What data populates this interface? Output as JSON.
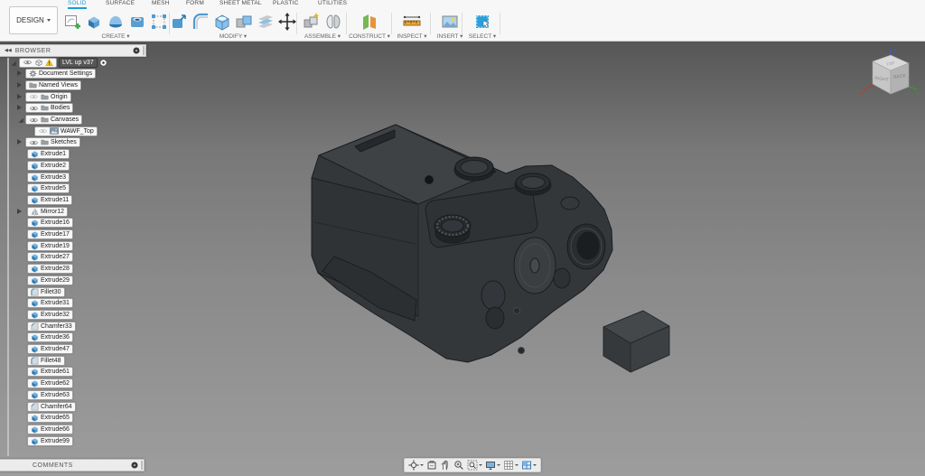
{
  "toolbar": {
    "design_label": "DESIGN",
    "tabs": [
      "SOLID",
      "SURFACE",
      "MESH",
      "FORM",
      "SHEET METAL",
      "PLASTIC",
      "UTILITIES"
    ],
    "active_tab": "SOLID",
    "accent_color": "#1e9bd7",
    "groups": [
      {
        "label": "CREATE",
        "icons": [
          "create-sketch-icon",
          "extrude-icon",
          "revolve-icon",
          "hole-icon",
          "pattern-icon"
        ]
      },
      {
        "label": "MODIFY",
        "icons": [
          "press-pull-icon",
          "fillet-icon",
          "shell-icon",
          "combine-icon",
          "offset-face-icon",
          "move-icon"
        ]
      },
      {
        "label": "ASSEMBLE",
        "icons": [
          "new-component-icon",
          "joint-icon"
        ]
      },
      {
        "label": "CONSTRUCT",
        "icons": [
          "construction-plane-icon"
        ]
      },
      {
        "label": "INSPECT",
        "icons": [
          "measure-icon"
        ]
      },
      {
        "label": "INSERT",
        "icons": [
          "insert-image-icon"
        ]
      },
      {
        "label": "SELECT",
        "icons": [
          "select-icon"
        ]
      }
    ]
  },
  "browser": {
    "title": "BROWSER",
    "selected_chip_color": "#565656",
    "warning_color": "#f2c21a",
    "nodes": [
      {
        "label": "LVL up v37",
        "level": 0,
        "expander": "open",
        "eye": "on",
        "icon": "component",
        "warning": true,
        "selected": true,
        "radio": true
      },
      {
        "label": "Document Settings",
        "level": 1,
        "expander": "closed",
        "icon": "gear"
      },
      {
        "label": "Named Views",
        "level": 1,
        "expander": "closed",
        "icon": "folder"
      },
      {
        "label": "Origin",
        "level": 1,
        "expander": "closed",
        "eye": "off",
        "icon": "folder"
      },
      {
        "label": "Bodies",
        "level": 1,
        "expander": "closed",
        "eye": "on",
        "icon": "folder"
      },
      {
        "label": "Canvases",
        "level": 1,
        "expander": "open",
        "eye": "on",
        "icon": "folder"
      },
      {
        "label": "WAWF_Top",
        "level": 2,
        "eye": "off",
        "icon": "image"
      },
      {
        "label": "Sketches",
        "level": 1,
        "expander": "closed",
        "eye": "on",
        "icon": "folder"
      }
    ],
    "features": [
      {
        "label": "Extrude1",
        "icon": "extrude"
      },
      {
        "label": "Extrude2",
        "icon": "extrude"
      },
      {
        "label": "Extrude3",
        "icon": "extrude"
      },
      {
        "label": "Extrude5",
        "icon": "extrude"
      },
      {
        "label": "Extrude11",
        "icon": "extrude"
      },
      {
        "label": "Mirror12",
        "icon": "mirror",
        "expander": "closed"
      },
      {
        "label": "Extrude16",
        "icon": "extrude"
      },
      {
        "label": "Extrude17",
        "icon": "extrude"
      },
      {
        "label": "Extrude19",
        "icon": "extrude"
      },
      {
        "label": "Extrude27",
        "icon": "extrude"
      },
      {
        "label": "Extrude28",
        "icon": "extrude"
      },
      {
        "label": "Extrude29",
        "icon": "extrude"
      },
      {
        "label": "Fillet30",
        "icon": "fillet"
      },
      {
        "label": "Extrude31",
        "icon": "extrude"
      },
      {
        "label": "Extrude32",
        "icon": "extrude"
      },
      {
        "label": "Chamfer33",
        "icon": "chamfer"
      },
      {
        "label": "Extrude36",
        "icon": "extrude"
      },
      {
        "label": "Extrude47",
        "icon": "extrude"
      },
      {
        "label": "Fillet48",
        "icon": "fillet"
      },
      {
        "label": "Extrude61",
        "icon": "extrude"
      },
      {
        "label": "Extrude62",
        "icon": "extrude"
      },
      {
        "label": "Extrude63",
        "icon": "extrude"
      },
      {
        "label": "Chamfer64",
        "icon": "chamfer"
      },
      {
        "label": "Extrude65",
        "icon": "extrude"
      },
      {
        "label": "Extrude66",
        "icon": "extrude"
      },
      {
        "label": "Extrude99",
        "icon": "extrude"
      }
    ]
  },
  "comments": {
    "title": "COMMENTS"
  },
  "viewcube": {
    "top_face": "TOP",
    "left_face": "RIGHT",
    "right_face": "BACK",
    "axes": [
      {
        "label": "X",
        "color": "#c0392b"
      },
      {
        "label": "Y",
        "color": "#2ea12e"
      },
      {
        "label": "Z",
        "color": "#3a5fd9"
      }
    ]
  },
  "nav_toolbar": {
    "buttons": [
      {
        "icon": "orbit-icon",
        "dropdown": true
      },
      {
        "icon": "look-at-icon",
        "dropdown": false
      },
      {
        "icon": "pan-icon",
        "dropdown": false
      },
      {
        "icon": "zoom-icon",
        "dropdown": false
      },
      {
        "icon": "fit-icon",
        "dropdown": true
      },
      {
        "icon": "display-settings-icon",
        "dropdown": true
      },
      {
        "icon": "grid-icon",
        "dropdown": true
      },
      {
        "icon": "viewports-icon",
        "dropdown": true
      }
    ]
  },
  "viewport": {
    "bg_top": "#565656",
    "bg_bottom": "#9d9d9d",
    "model_color": "#34373a"
  }
}
